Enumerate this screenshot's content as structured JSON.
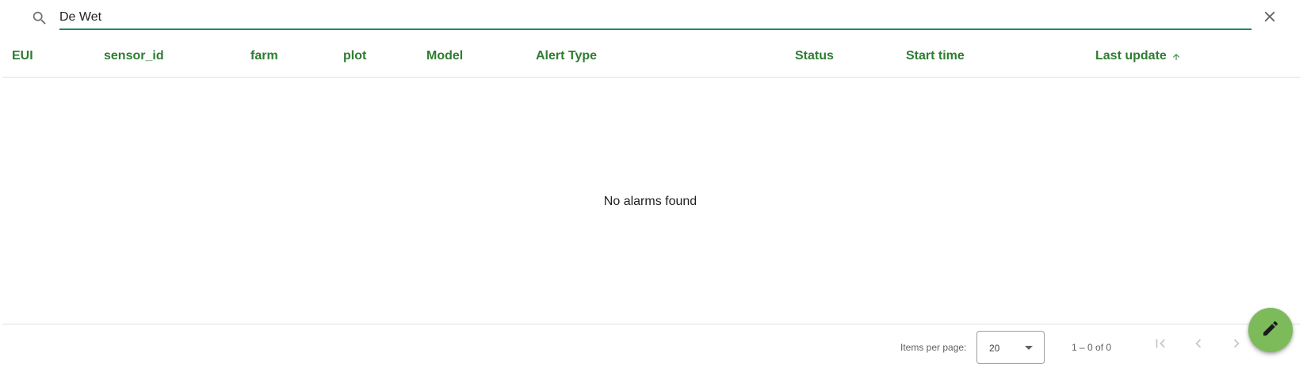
{
  "search": {
    "value": "De Wet",
    "placeholder": ""
  },
  "table": {
    "columns": [
      "EUI",
      "sensor_id",
      "farm",
      "plot",
      "Model",
      "Alert Type",
      "Status",
      "Start time",
      "Last update"
    ],
    "sorted_column": "Last update",
    "sort_direction": "ascending",
    "empty_message": "No alarms found"
  },
  "paginator": {
    "items_per_page_label": "Items per page:",
    "page_size": "20",
    "range_label": "1 – 0 of 0"
  },
  "colors": {
    "accent": "#2e7d32",
    "input_underline": "#1a8a63",
    "fab": "#7cba5a"
  },
  "icons": {
    "search": "search-icon",
    "clear": "close-icon",
    "sort": "arrow-up-icon",
    "first_page": "first-page-icon",
    "prev_page": "chevron-left-icon",
    "next_page": "chevron-right-icon",
    "fab": "pencil-icon"
  }
}
